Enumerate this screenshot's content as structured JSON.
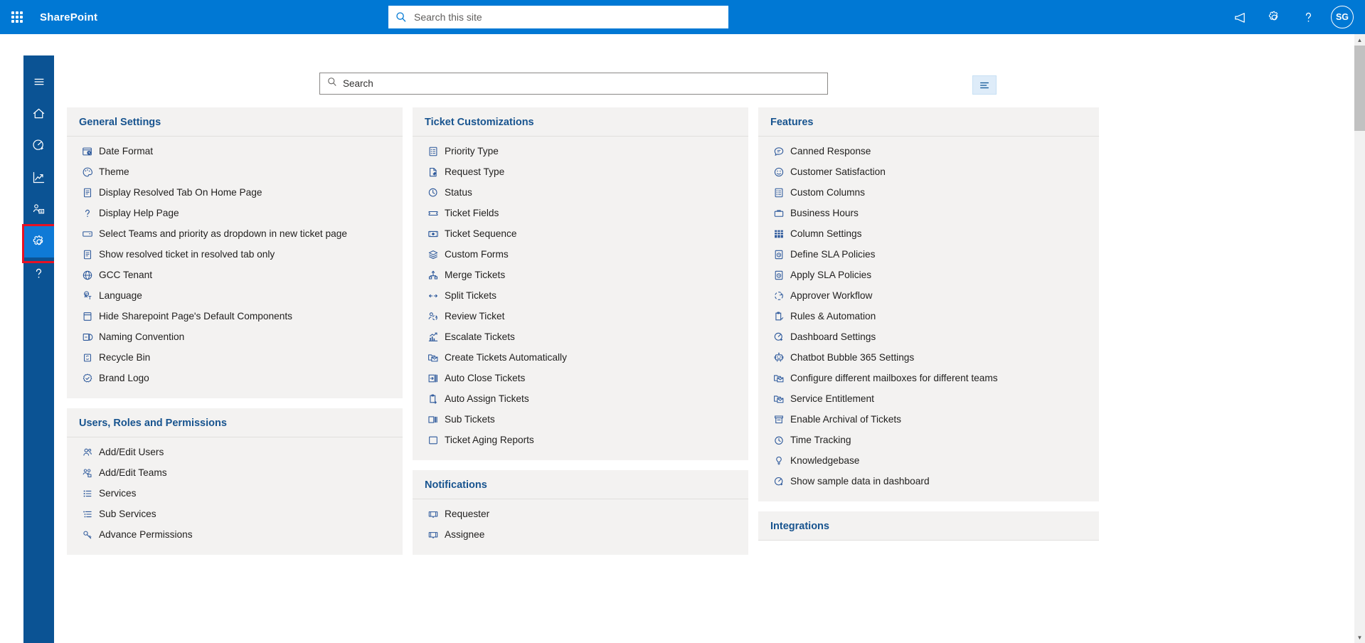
{
  "suite": {
    "waffle_label": "app-launcher",
    "title": "SharePoint",
    "search_placeholder": "Search this site",
    "icons": [
      "megaphone-icon",
      "gear-icon",
      "help-icon"
    ],
    "avatar_initials": "SG"
  },
  "rail": {
    "items": [
      {
        "name": "hamburger-menu",
        "label": "Menu"
      },
      {
        "name": "home",
        "label": "Home"
      },
      {
        "name": "dashboard",
        "label": "Dashboard"
      },
      {
        "name": "reports",
        "label": "Reports"
      },
      {
        "name": "teams",
        "label": "Teams"
      },
      {
        "name": "settings",
        "label": "Settings"
      },
      {
        "name": "help",
        "label": "Help"
      }
    ],
    "selected": "settings"
  },
  "toolbar": {
    "search_placeholder": "Search",
    "search_value": "",
    "filter_label": "filter"
  },
  "columns": [
    {
      "cards": [
        {
          "title": "General Settings",
          "items": [
            {
              "icon": "date-format-icon",
              "label": "Date Format"
            },
            {
              "icon": "palette-icon",
              "label": "Theme"
            },
            {
              "icon": "document-icon",
              "label": "Display Resolved Tab On Home Page"
            },
            {
              "icon": "question-icon",
              "label": "Display Help Page"
            },
            {
              "icon": "dropdown-icon",
              "label": "Select Teams and priority as dropdown in new ticket page"
            },
            {
              "icon": "document-icon",
              "label": "Show resolved ticket in resolved tab only"
            },
            {
              "icon": "globe-icon",
              "label": "GCC Tenant"
            },
            {
              "icon": "translate-icon",
              "label": "Language"
            },
            {
              "icon": "page-icon",
              "label": "Hide Sharepoint Page's Default Components"
            },
            {
              "icon": "naming-icon",
              "label": "Naming Convention"
            },
            {
              "icon": "recycle-bin-icon",
              "label": "Recycle Bin"
            },
            {
              "icon": "badge-icon",
              "label": "Brand Logo"
            }
          ]
        },
        {
          "title": "Users, Roles and Permissions",
          "items": [
            {
              "icon": "people-icon",
              "label": "Add/Edit Users"
            },
            {
              "icon": "team-icon",
              "label": "Add/Edit Teams"
            },
            {
              "icon": "list-icon",
              "label": "Services"
            },
            {
              "icon": "sub-list-icon",
              "label": "Sub Services"
            },
            {
              "icon": "key-icon",
              "label": "Advance Permissions"
            }
          ]
        }
      ]
    },
    {
      "cards": [
        {
          "title": "Ticket Customizations",
          "items": [
            {
              "icon": "priority-icon",
              "label": "Priority Type"
            },
            {
              "icon": "request-icon",
              "label": "Request Type"
            },
            {
              "icon": "clock-icon",
              "label": "Status"
            },
            {
              "icon": "ticket-icon",
              "label": "Ticket Fields"
            },
            {
              "icon": "sequence-icon",
              "label": "Ticket Sequence"
            },
            {
              "icon": "layers-icon",
              "label": "Custom Forms"
            },
            {
              "icon": "merge-icon",
              "label": "Merge Tickets"
            },
            {
              "icon": "split-icon",
              "label": "Split Tickets"
            },
            {
              "icon": "review-icon",
              "label": "Review Ticket"
            },
            {
              "icon": "escalate-icon",
              "label": "Escalate Tickets"
            },
            {
              "icon": "mail-folder-icon",
              "label": "Create Tickets Automatically"
            },
            {
              "icon": "auto-close-icon",
              "label": "Auto Close Tickets"
            },
            {
              "icon": "clipboard-arrow-icon",
              "label": "Auto Assign Tickets"
            },
            {
              "icon": "sub-tickets-icon",
              "label": "Sub Tickets"
            },
            {
              "icon": "report-icon",
              "label": "Ticket Aging Reports"
            }
          ]
        },
        {
          "title": "Notifications",
          "items": [
            {
              "icon": "requester-icon",
              "label": "Requester"
            },
            {
              "icon": "assignee-icon",
              "label": "Assignee"
            }
          ]
        }
      ]
    },
    {
      "cards": [
        {
          "title": "Features",
          "items": [
            {
              "icon": "canned-response-icon",
              "label": "Canned Response"
            },
            {
              "icon": "smiley-icon",
              "label": "Customer Satisfaction"
            },
            {
              "icon": "custom-columns-icon",
              "label": "Custom Columns"
            },
            {
              "icon": "briefcase-icon",
              "label": "Business Hours"
            },
            {
              "icon": "grid-icon",
              "label": "Column Settings"
            },
            {
              "icon": "sla-icon",
              "label": "Define SLA Policies"
            },
            {
              "icon": "sla-icon",
              "label": "Apply SLA Policies"
            },
            {
              "icon": "workflow-icon",
              "label": "Approver Workflow"
            },
            {
              "icon": "clipboard-icon",
              "label": "Rules & Automation"
            },
            {
              "icon": "dashboard-icon",
              "label": "Dashboard Settings"
            },
            {
              "icon": "robot-icon",
              "label": "Chatbot Bubble 365 Settings"
            },
            {
              "icon": "mail-folder-icon",
              "label": "Configure different mailboxes for different teams"
            },
            {
              "icon": "mail-folder-icon",
              "label": "Service Entitlement"
            },
            {
              "icon": "archive-icon",
              "label": "Enable Archival of Tickets"
            },
            {
              "icon": "time-icon",
              "label": "Time Tracking"
            },
            {
              "icon": "knowledge-icon",
              "label": "Knowledgebase"
            },
            {
              "icon": "sample-data-icon",
              "label": "Show sample data in dashboard"
            }
          ]
        },
        {
          "title": "Integrations",
          "items": []
        }
      ]
    }
  ],
  "colors": {
    "brand": "#0078d4",
    "rail": "#0b5394",
    "rail_selected": "#0f7ad6",
    "card_bg": "#f3f2f1",
    "heading": "#18548f",
    "highlight": "#e81123"
  }
}
